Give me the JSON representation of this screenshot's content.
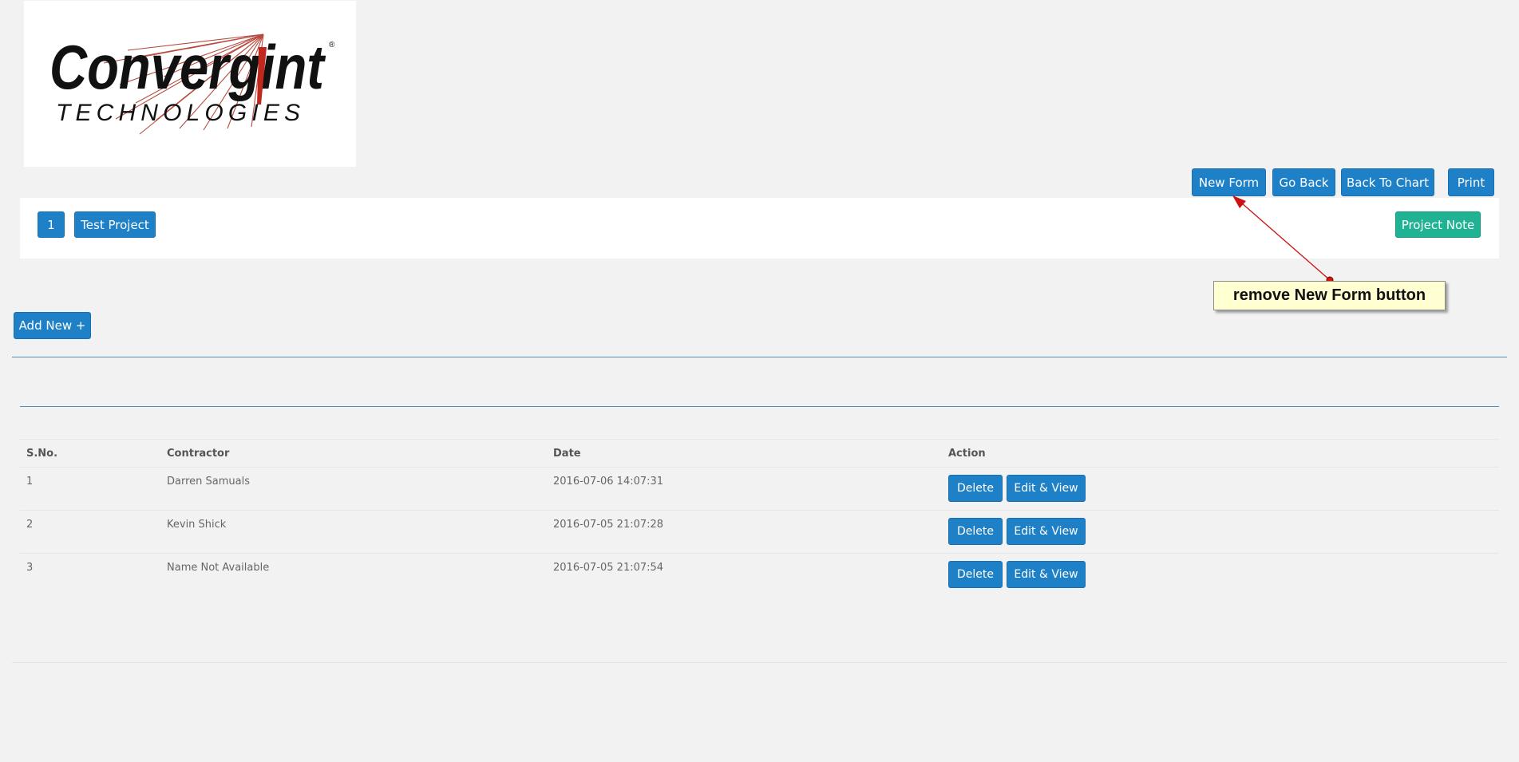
{
  "logo": {
    "brand_line1": "Convergint",
    "brand_line2": "TECHNOLOGIES",
    "registered_mark": "®"
  },
  "toolbar": {
    "new_form": "New Form",
    "go_back": "Go Back",
    "back_to_chart": "Back To Chart",
    "print": "Print"
  },
  "project_bar": {
    "number": "1",
    "name": "Test Project",
    "note_label": "Project Note"
  },
  "add_new_label": "Add New +",
  "annotation": {
    "text": "remove New Form button"
  },
  "table": {
    "headers": [
      "S.No.",
      "Contractor",
      "Date",
      "Action"
    ],
    "rows": [
      {
        "sno": "1",
        "contractor": "Darren Samuals",
        "date": "2016-07-06 14:07:31",
        "delete": "Delete",
        "edit": "Edit & View"
      },
      {
        "sno": "2",
        "contractor": "Kevin Shick",
        "date": "2016-07-05 21:07:28",
        "delete": "Delete",
        "edit": "Edit & View"
      },
      {
        "sno": "3",
        "contractor": "Name Not Available",
        "date": "2016-07-05 21:07:54",
        "delete": "Delete",
        "edit": "Edit & View"
      }
    ]
  },
  "colors": {
    "primary": "#1e81c8",
    "success": "#1fb394",
    "background": "#f2f2f2",
    "callout_bg": "#ffffd2",
    "annotation_arrow": "#cc1111"
  },
  "icons": {
    "logo_burst": "starburst-lines-icon"
  }
}
